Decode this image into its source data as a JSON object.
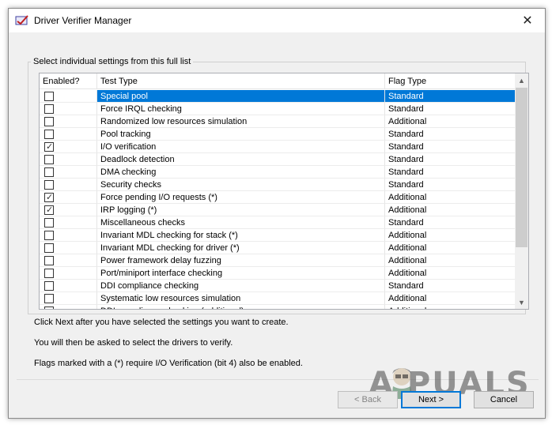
{
  "window": {
    "title": "Driver Verifier Manager",
    "close_glyph": "✕",
    "app_icon": "driver-verifier-icon"
  },
  "group": {
    "label": "Select individual settings from this full list"
  },
  "table": {
    "columns": [
      "Enabled?",
      "Test Type",
      "Flag Type"
    ],
    "rows": [
      {
        "enabled": false,
        "test": "Special pool",
        "flag": "Standard",
        "selected": true
      },
      {
        "enabled": false,
        "test": "Force IRQL checking",
        "flag": "Standard"
      },
      {
        "enabled": false,
        "test": "Randomized low resources simulation",
        "flag": "Additional"
      },
      {
        "enabled": false,
        "test": "Pool tracking",
        "flag": "Standard"
      },
      {
        "enabled": true,
        "test": "I/O verification",
        "flag": "Standard"
      },
      {
        "enabled": false,
        "test": "Deadlock detection",
        "flag": "Standard"
      },
      {
        "enabled": false,
        "test": "DMA checking",
        "flag": "Standard"
      },
      {
        "enabled": false,
        "test": "Security checks",
        "flag": "Standard"
      },
      {
        "enabled": true,
        "test": "Force pending I/O requests (*)",
        "flag": "Additional"
      },
      {
        "enabled": true,
        "test": "IRP logging (*)",
        "flag": "Additional"
      },
      {
        "enabled": false,
        "test": "Miscellaneous checks",
        "flag": "Standard"
      },
      {
        "enabled": false,
        "test": "Invariant MDL checking for stack (*)",
        "flag": "Additional"
      },
      {
        "enabled": false,
        "test": "Invariant MDL checking for driver (*)",
        "flag": "Additional"
      },
      {
        "enabled": false,
        "test": "Power framework delay fuzzing",
        "flag": "Additional"
      },
      {
        "enabled": false,
        "test": "Port/miniport interface checking",
        "flag": "Additional"
      },
      {
        "enabled": false,
        "test": "DDI compliance checking",
        "flag": "Standard"
      },
      {
        "enabled": false,
        "test": "Systematic low resources simulation",
        "flag": "Additional"
      },
      {
        "enabled": false,
        "test": "DDI compliance checking (additional)",
        "flag": "Additional"
      }
    ],
    "scroll_up": "▲",
    "scroll_down": "▼"
  },
  "info": {
    "line1": "Click Next after you have selected the settings you want to create.",
    "line2": "You will then be asked to select the drivers to verify.",
    "line3": "Flags marked with a (*) require I/O Verification (bit 4) also be enabled."
  },
  "buttons": {
    "back": "< Back",
    "next": "Next >",
    "cancel": "Cancel"
  },
  "watermark": {
    "text": "A  PUALS"
  },
  "colors": {
    "selection": "#0078d7",
    "window_bg": "#f0f0f0"
  }
}
